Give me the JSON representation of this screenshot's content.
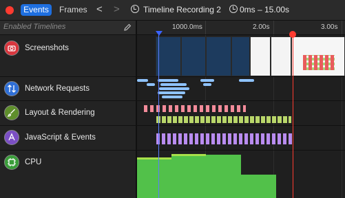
{
  "toolbar": {
    "tab_events": "Events",
    "tab_frames": "Frames",
    "back_glyph": "<",
    "forward_glyph": ">",
    "recording_title": "Timeline Recording 2",
    "time_range": "0ms – 15.00s"
  },
  "filter": {
    "placeholder": "Enabled Timelines"
  },
  "ruler": {
    "labels": [
      "1000.0ms",
      "2.00s",
      "3.00s"
    ]
  },
  "timelines": [
    {
      "label": "Screenshots",
      "icon": "camera-icon",
      "color": "#d9363e"
    },
    {
      "label": "Network Requests",
      "icon": "arrows-updown-icon",
      "color": "#2f6fd6"
    },
    {
      "label": "Layout & Rendering",
      "icon": "paintbrush-icon",
      "color": "#5f8f2c"
    },
    {
      "label": "JavaScript & Events",
      "icon": "script-icon",
      "color": "#7b4fc4"
    },
    {
      "label": "CPU",
      "icon": "chip-icon",
      "color": "#3a9d3a"
    }
  ],
  "colors": {
    "accent": "#1e6fe0",
    "record": "#ff3b30",
    "network": "#8fc3ff",
    "layout": "#f28b9a",
    "layout_secondary": "#b9d66a",
    "javascript": "#b98cf0",
    "cpu": "#52c14a"
  }
}
